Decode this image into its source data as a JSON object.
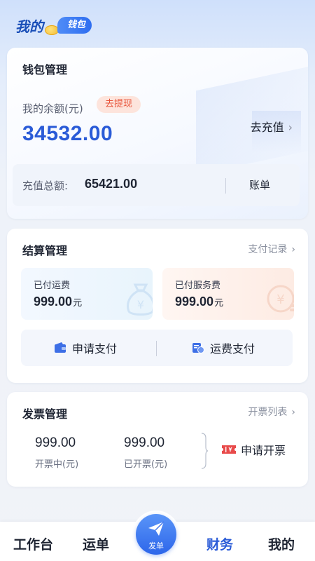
{
  "header": {
    "title": "我的",
    "badge": "钱包"
  },
  "wallet": {
    "title": "钱包管理",
    "balance_label": "我的余额(元)",
    "withdraw_label": "去提现",
    "balance": "34532.00",
    "recharge_label": "去充值",
    "total_label": "充值总额:",
    "total_value": "65421.00",
    "bill_label": "账单"
  },
  "settlement": {
    "title": "结算管理",
    "records_label": "支付记录",
    "paid_freight_label": "已付运费",
    "paid_freight_value": "999.00",
    "paid_service_label": "已付服务费",
    "paid_service_value": "999.00",
    "unit": "元",
    "apply_pay_label": "申请支付",
    "freight_pay_label": "运费支付"
  },
  "invoice": {
    "title": "发票管理",
    "list_label": "开票列表",
    "invoicing_value": "999.00",
    "invoicing_label": "开票中(元)",
    "invoiced_value": "999.00",
    "invoiced_label": "已开票(元)",
    "apply_label": "申请开票"
  },
  "nav": {
    "workbench": "工作台",
    "waybill": "运单",
    "dispatch": "发单",
    "finance": "财务",
    "mine": "我的",
    "active": "财务"
  },
  "colors": {
    "accent": "#2a5bd7",
    "withdraw": "#e8543a",
    "invoice_icon": "#e84a4a"
  }
}
